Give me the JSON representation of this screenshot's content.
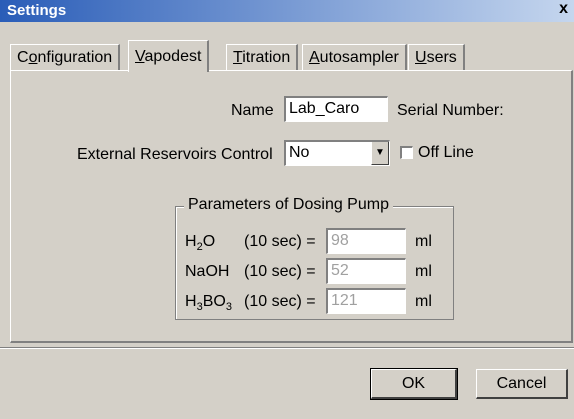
{
  "window": {
    "title": "Settings",
    "close_glyph": "x"
  },
  "tabs": [
    {
      "label": "Configuration",
      "underline_index": 1,
      "active": false
    },
    {
      "label": "Vapodest",
      "underline_index": 0,
      "active": true
    },
    {
      "label": "Titration",
      "underline_index": 0,
      "active": false
    },
    {
      "label": "Autosampler",
      "underline_index": 0,
      "active": false
    },
    {
      "label": "Users",
      "underline_index": 0,
      "active": false
    }
  ],
  "form": {
    "name_label": "Name",
    "name_value": "Lab_Caro",
    "serial_label": "Serial Number:",
    "ext_res_label": "External Reservoirs Control",
    "ext_res_value": "No",
    "offline_label": "Off Line",
    "offline_checked": false
  },
  "dosing_pump": {
    "group_title": "Parameters of Dosing Pump",
    "rows": [
      {
        "label_main": "H",
        "label_sub": "2",
        "label_rest": "O",
        "time": "(10 sec) =",
        "value": "98",
        "unit": "ml"
      },
      {
        "label_main": "NaOH",
        "label_sub": "",
        "label_rest": "",
        "time": "(10 sec) =",
        "value": "52",
        "unit": "ml"
      },
      {
        "label_main": "H",
        "label_sub": "3",
        "label_rest": "BO",
        "label_sub2": "3",
        "time": "(10 sec) =",
        "value": "121",
        "unit": "ml"
      }
    ]
  },
  "buttons": {
    "ok_label": "OK",
    "cancel_label": "Cancel"
  },
  "icons": {
    "dropdown": "chevron-down-icon",
    "close": "close-icon"
  }
}
